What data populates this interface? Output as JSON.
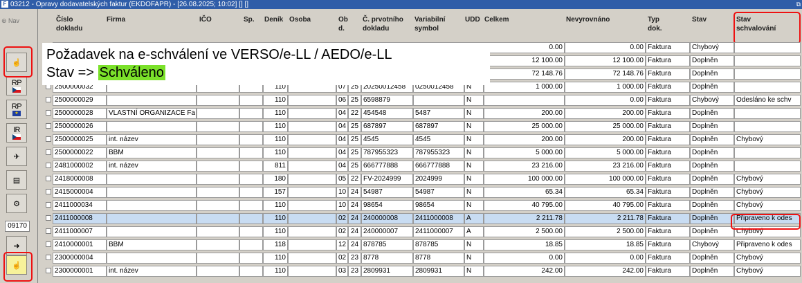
{
  "window": {
    "title": "03212 - Opravy dodavatelských faktur (EKDOFAPR) - [26.08.2025; 10:02] [] []",
    "icon": "app-icon",
    "controls": "restore-icon"
  },
  "sidebar": {
    "nav_label": "Nav",
    "buttons": [
      {
        "name": "approval-hand-icon"
      },
      {
        "name": "rp-cz-button",
        "label": "RP",
        "flag": "cz"
      },
      {
        "name": "rp-eu-button",
        "label": "RP",
        "flag": "eu"
      },
      {
        "name": "ir-cz-button",
        "label": "IR",
        "flag": "cz"
      },
      {
        "name": "plane-icon"
      },
      {
        "name": "document-icon"
      },
      {
        "name": "settings-icon"
      },
      {
        "name": "export-icon"
      },
      {
        "name": "approval-hand-icon"
      }
    ],
    "counter": "09170"
  },
  "overlay": {
    "line1": "Požadavek na e-schválení ve VERSO/e-LL / AEDO/e-LL",
    "line2_prefix": "Stav => ",
    "line2_highlight": "Schváleno"
  },
  "columns": [
    "Číslo\ndokladu",
    "Firma",
    "IČO",
    "Sp.",
    "Deník",
    "Osoba",
    "Ob\nd.",
    "Č. prvotního\ndokladu",
    "Variabilní\nsymbol",
    "UDD",
    "Celkem",
    "Nevyrovnáno",
    "Typ\ndok.",
    "Stav",
    "Stav\nschvalování"
  ],
  "rows": [
    {
      "cislo": "",
      "firma": "",
      "ico": "",
      "sp": "",
      "denik": "",
      "osoba": "",
      "ob1": "",
      "ob2": "",
      "prvotni": "",
      "var": "",
      "udd": "",
      "celkem": "0.00",
      "nevyr": "0.00",
      "typ": "Faktura",
      "stav": "Chybový",
      "schval": ""
    },
    {
      "cislo": "",
      "firma": "",
      "ico": "",
      "sp": "",
      "denik": "",
      "osoba": "",
      "ob1": "",
      "ob2": "",
      "prvotni": "",
      "var": "",
      "udd": "",
      "celkem": "12 100.00",
      "nevyr": "12 100.00",
      "typ": "Faktura",
      "stav": "Doplněn",
      "schval": ""
    },
    {
      "cislo": "",
      "firma": "",
      "ico": "",
      "sp": "",
      "denik": "",
      "osoba": "",
      "ob1": "",
      "ob2": "",
      "prvotni": "",
      "var": "",
      "udd": "",
      "celkem": "72 148.76",
      "nevyr": "72 148.76",
      "typ": "Faktura",
      "stav": "Doplněn",
      "schval": ""
    },
    {
      "cislo": "2500000032",
      "firma": "",
      "ico": "",
      "sp": "",
      "denik": "110",
      "osoba": "",
      "ob1": "07",
      "ob2": "25",
      "prvotni": "20250012458",
      "var": "0250012458",
      "udd": "N",
      "celkem": "1 000.00",
      "nevyr": "1 000.00",
      "typ": "Faktura",
      "stav": "Doplněn",
      "schval": ""
    },
    {
      "cislo": "2500000029",
      "firma": "",
      "ico": "",
      "sp": "",
      "denik": "110",
      "osoba": "",
      "ob1": "06",
      "ob2": "25",
      "prvotni": "6598879",
      "var": "",
      "udd": "N",
      "celkem": "",
      "nevyr": "0.00",
      "typ": "Faktura",
      "stav": "Chybový",
      "schval": "Odesláno ke schv"
    },
    {
      "cislo": "2500000028",
      "firma": "VLASTNÍ ORGANIZACE Fa",
      "ico": "",
      "sp": "",
      "denik": "110",
      "osoba": "",
      "ob1": "04",
      "ob2": "22",
      "prvotni": "454548",
      "var": "5487",
      "udd": "N",
      "celkem": "200.00",
      "nevyr": "200.00",
      "typ": "Faktura",
      "stav": "Doplněn",
      "schval": ""
    },
    {
      "cislo": "2500000026",
      "firma": "",
      "ico": "",
      "sp": "",
      "denik": "110",
      "osoba": "",
      "ob1": "04",
      "ob2": "25",
      "prvotni": "687897",
      "var": "687897",
      "udd": "N",
      "celkem": "25 000.00",
      "nevyr": "25 000.00",
      "typ": "Faktura",
      "stav": "Doplněn",
      "schval": ""
    },
    {
      "cislo": "2500000025",
      "firma": "int. název",
      "ico": "",
      "sp": "",
      "denik": "110",
      "osoba": "",
      "ob1": "04",
      "ob2": "25",
      "prvotni": "4545",
      "var": "4545",
      "udd": "N",
      "celkem": "200.00",
      "nevyr": "200.00",
      "typ": "Faktura",
      "stav": "Doplněn",
      "schval": "Chybový"
    },
    {
      "cislo": "2500000022",
      "firma": "BBM",
      "ico": "",
      "sp": "",
      "denik": "110",
      "osoba": "",
      "ob1": "04",
      "ob2": "25",
      "prvotni": "787955323",
      "var": "787955323",
      "udd": "N",
      "celkem": "5 000.00",
      "nevyr": "5 000.00",
      "typ": "Faktura",
      "stav": "Doplněn",
      "schval": ""
    },
    {
      "cislo": "2481000002",
      "firma": "int. název",
      "ico": "",
      "sp": "",
      "denik": "811",
      "osoba": "",
      "ob1": "04",
      "ob2": "25",
      "prvotni": "666777888",
      "var": "666777888",
      "udd": "N",
      "celkem": "23 216.00",
      "nevyr": "23 216.00",
      "typ": "Faktura",
      "stav": "Doplněn",
      "schval": ""
    },
    {
      "cislo": "2418000008",
      "firma": "",
      "ico": "",
      "sp": "",
      "denik": "180",
      "osoba": "",
      "ob1": "05",
      "ob2": "22",
      "prvotni": "FV-2024999",
      "var": "2024999",
      "udd": "N",
      "celkem": "100 000.00",
      "nevyr": "100 000.00",
      "typ": "Faktura",
      "stav": "Doplněn",
      "schval": "Chybový"
    },
    {
      "cislo": "2415000004",
      "firma": "",
      "ico": "",
      "sp": "",
      "denik": "157",
      "osoba": "",
      "ob1": "10",
      "ob2": "24",
      "prvotni": "54987",
      "var": "54987",
      "udd": "N",
      "celkem": "65.34",
      "nevyr": "65.34",
      "typ": "Faktura",
      "stav": "Doplněn",
      "schval": "Chybový"
    },
    {
      "cislo": "2411000034",
      "firma": "",
      "ico": "",
      "sp": "",
      "denik": "110",
      "osoba": "",
      "ob1": "10",
      "ob2": "24",
      "prvotni": "98654",
      "var": "98654",
      "udd": "N",
      "celkem": "40 795.00",
      "nevyr": "40 795.00",
      "typ": "Faktura",
      "stav": "Doplněn",
      "schval": "Chybový"
    },
    {
      "cislo": "2411000008",
      "firma": "",
      "ico": "",
      "sp": "",
      "denik": "110",
      "osoba": "",
      "ob1": "02",
      "ob2": "24",
      "prvotni": "240000008",
      "var": "2411000008",
      "udd": "A",
      "celkem": "2 211.78",
      "nevyr": "2 211.78",
      "typ": "Faktura",
      "stav": "Doplněn",
      "schval": "Připraveno k odes",
      "selected": true
    },
    {
      "cislo": "2411000007",
      "firma": "",
      "ico": "",
      "sp": "",
      "denik": "110",
      "osoba": "",
      "ob1": "02",
      "ob2": "24",
      "prvotni": "240000007",
      "var": "2411000007",
      "udd": "A",
      "celkem": "2 500.00",
      "nevyr": "2 500.00",
      "typ": "Faktura",
      "stav": "Doplněn",
      "schval": "Chybový"
    },
    {
      "cislo": "2410000001",
      "firma": "BBM",
      "ico": "",
      "sp": "",
      "denik": "118",
      "osoba": "",
      "ob1": "12",
      "ob2": "24",
      "prvotni": "878785",
      "var": "878785",
      "udd": "N",
      "celkem": "18.85",
      "nevyr": "18.85",
      "typ": "Faktura",
      "stav": "Chybový",
      "schval": "Připraveno k odes"
    },
    {
      "cislo": "2300000004",
      "firma": "",
      "ico": "",
      "sp": "",
      "denik": "110",
      "osoba": "",
      "ob1": "02",
      "ob2": "23",
      "prvotni": "8778",
      "var": "8778",
      "udd": "N",
      "celkem": "0.00",
      "nevyr": "0.00",
      "typ": "Faktura",
      "stav": "Doplněn",
      "schval": "Chybový"
    },
    {
      "cislo": "2300000001",
      "firma": "int. název",
      "ico": "",
      "sp": "",
      "denik": "110",
      "osoba": "",
      "ob1": "03",
      "ob2": "23",
      "prvotni": "2809931",
      "var": "2809931",
      "udd": "N",
      "celkem": "242.00",
      "nevyr": "242.00",
      "typ": "Faktura",
      "stav": "Doplněn",
      "schval": "Chybový"
    }
  ],
  "colors": {
    "selected_row": "#c8dcf2",
    "highlight": "#7be12a",
    "annotation": "#ee1111"
  }
}
